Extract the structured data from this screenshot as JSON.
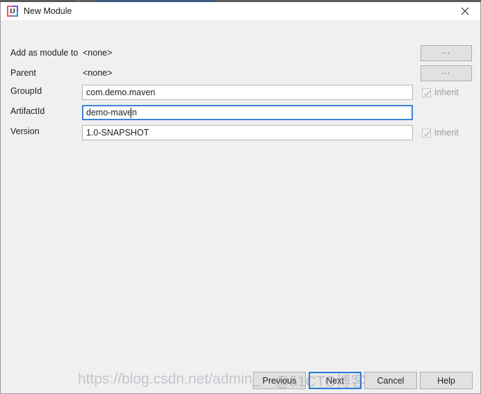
{
  "window": {
    "title": "New Module",
    "app_icon": "intellij-idea-icon",
    "close_icon": "close-icon"
  },
  "form": {
    "rows": [
      {
        "label": "Add as module to",
        "value": "<none>",
        "type": "static",
        "browse_label": "..."
      },
      {
        "label": "Parent",
        "value": "<none>",
        "type": "static",
        "browse_label": "..."
      },
      {
        "label": "GroupId",
        "value": "com.demo.maven",
        "type": "input",
        "focused": false,
        "inherit_label": "Inherit",
        "inherit_checked": true
      },
      {
        "label": "ArtifactId",
        "value": "demo-maven",
        "type": "input",
        "focused": true,
        "inherit_label": "",
        "inherit_checked": false
      },
      {
        "label": "Version",
        "value": "1.0-SNAPSHOT",
        "type": "input",
        "focused": false,
        "inherit_label": "Inherit",
        "inherit_checked": true
      }
    ]
  },
  "footer": {
    "previous_label": "Previous",
    "next_label": "Next",
    "cancel_label": "Cancel",
    "help_label": "Help"
  },
  "watermark": {
    "left_text": "https://blog.csdn.net/admin_",
    "right_text": "@51CTO博客"
  },
  "colors": {
    "accent": "#2579da",
    "dialog_bg": "#f0f0f0",
    "field_bg": "#ffffff",
    "focus_border": "#3c84d8",
    "disabled_text": "#9a9a9a"
  }
}
